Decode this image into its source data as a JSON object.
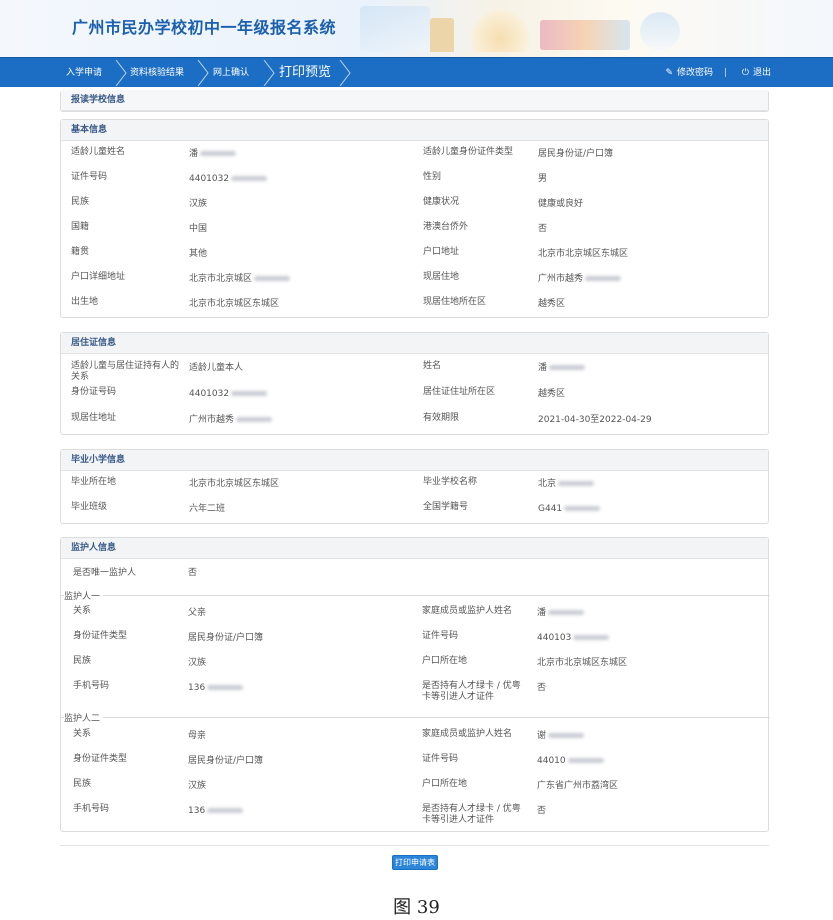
{
  "header": {
    "title": "广州市民办学校初中一年级报名系统"
  },
  "nav": {
    "crumbs": [
      "入学申请",
      "资料核验结果",
      "网上确认",
      "打印预览"
    ],
    "change_password": "修改密码",
    "separator": "|",
    "logout": "退出"
  },
  "school_section": {
    "title": "报读学校信息"
  },
  "basic": {
    "title": "基本信息",
    "rows": [
      {
        "l1": "适龄儿童姓名",
        "v1": "潘",
        "l2": "适龄儿童身份证件类型",
        "v2": "居民身份证/户口簿"
      },
      {
        "l1": "证件号码",
        "v1": "4401032",
        "l2": "性别",
        "v2": "男"
      },
      {
        "l1": "民族",
        "v1": "汉族",
        "l2": "健康状况",
        "v2": "健康或良好"
      },
      {
        "l1": "国籍",
        "v1": "中国",
        "l2": "港澳台侨外",
        "v2": "否"
      },
      {
        "l1": "籍贯",
        "v1": "其他",
        "l2": "户口地址",
        "v2": "北京市北京城区东城区"
      },
      {
        "l1": "户口详细地址",
        "v1": "北京市北京城区",
        "l2": "现居住地",
        "v2": "广州市越秀"
      },
      {
        "l1": "出生地",
        "v1": "北京市北京城区东城区",
        "l2": "现居住地所在区",
        "v2": "越秀区"
      }
    ]
  },
  "residence": {
    "title": "居住证信息",
    "rows": [
      {
        "l1": "适龄儿童与居住证持有人的关系",
        "v1": "适龄儿童本人",
        "l2": "姓名",
        "v2": "潘"
      },
      {
        "l1": "身份证号码",
        "v1": "4401032",
        "l2": "居住证住址所在区",
        "v2": "越秀区"
      },
      {
        "l1": "现居住地址",
        "v1": "广州市越秀",
        "l2": "有效期限",
        "v2": "2021-04-30至2022-04-29"
      }
    ]
  },
  "primary": {
    "title": "毕业小学信息",
    "rows": [
      {
        "l1": "毕业所在地",
        "v1": "北京市北京城区东城区",
        "l2": "毕业学校名称",
        "v2": "北京"
      },
      {
        "l1": "毕业班级",
        "v1": "六年二班",
        "l2": "全国学籍号",
        "v2": "G441"
      }
    ]
  },
  "guardian": {
    "title": "监护人信息",
    "only_label": "是否唯一监护人",
    "only_value": "否",
    "g1_title": "监护人一",
    "g1": [
      {
        "l1": "关系",
        "v1": "父亲",
        "l2": "家庭成员或监护人姓名",
        "v2": "潘"
      },
      {
        "l1": "身份证件类型",
        "v1": "居民身份证/户口簿",
        "l2": "证件号码",
        "v2": "440103"
      },
      {
        "l1": "民族",
        "v1": "汉族",
        "l2": "户口所在地",
        "v2": "北京市北京城区东城区"
      },
      {
        "l1": "手机号码",
        "v1": "136",
        "l2": "是否持有人才绿卡 / 优粤卡等引进人才证件",
        "v2": "否"
      }
    ],
    "g2_title": "监护人二",
    "g2": [
      {
        "l1": "关系",
        "v1": "母亲",
        "l2": "家庭成员或监护人姓名",
        "v2": "谢"
      },
      {
        "l1": "身份证件类型",
        "v1": "居民身份证/户口簿",
        "l2": "证件号码",
        "v2": "44010"
      },
      {
        "l1": "民族",
        "v1": "汉族",
        "l2": "户口所在地",
        "v2": "广东省广州市荔湾区"
      },
      {
        "l1": "手机号码",
        "v1": "136",
        "l2": "是否持有人才绿卡 / 优粤卡等引进人才证件",
        "v2": "否"
      }
    ]
  },
  "print_button": "打印申请表",
  "caption": "图 39"
}
